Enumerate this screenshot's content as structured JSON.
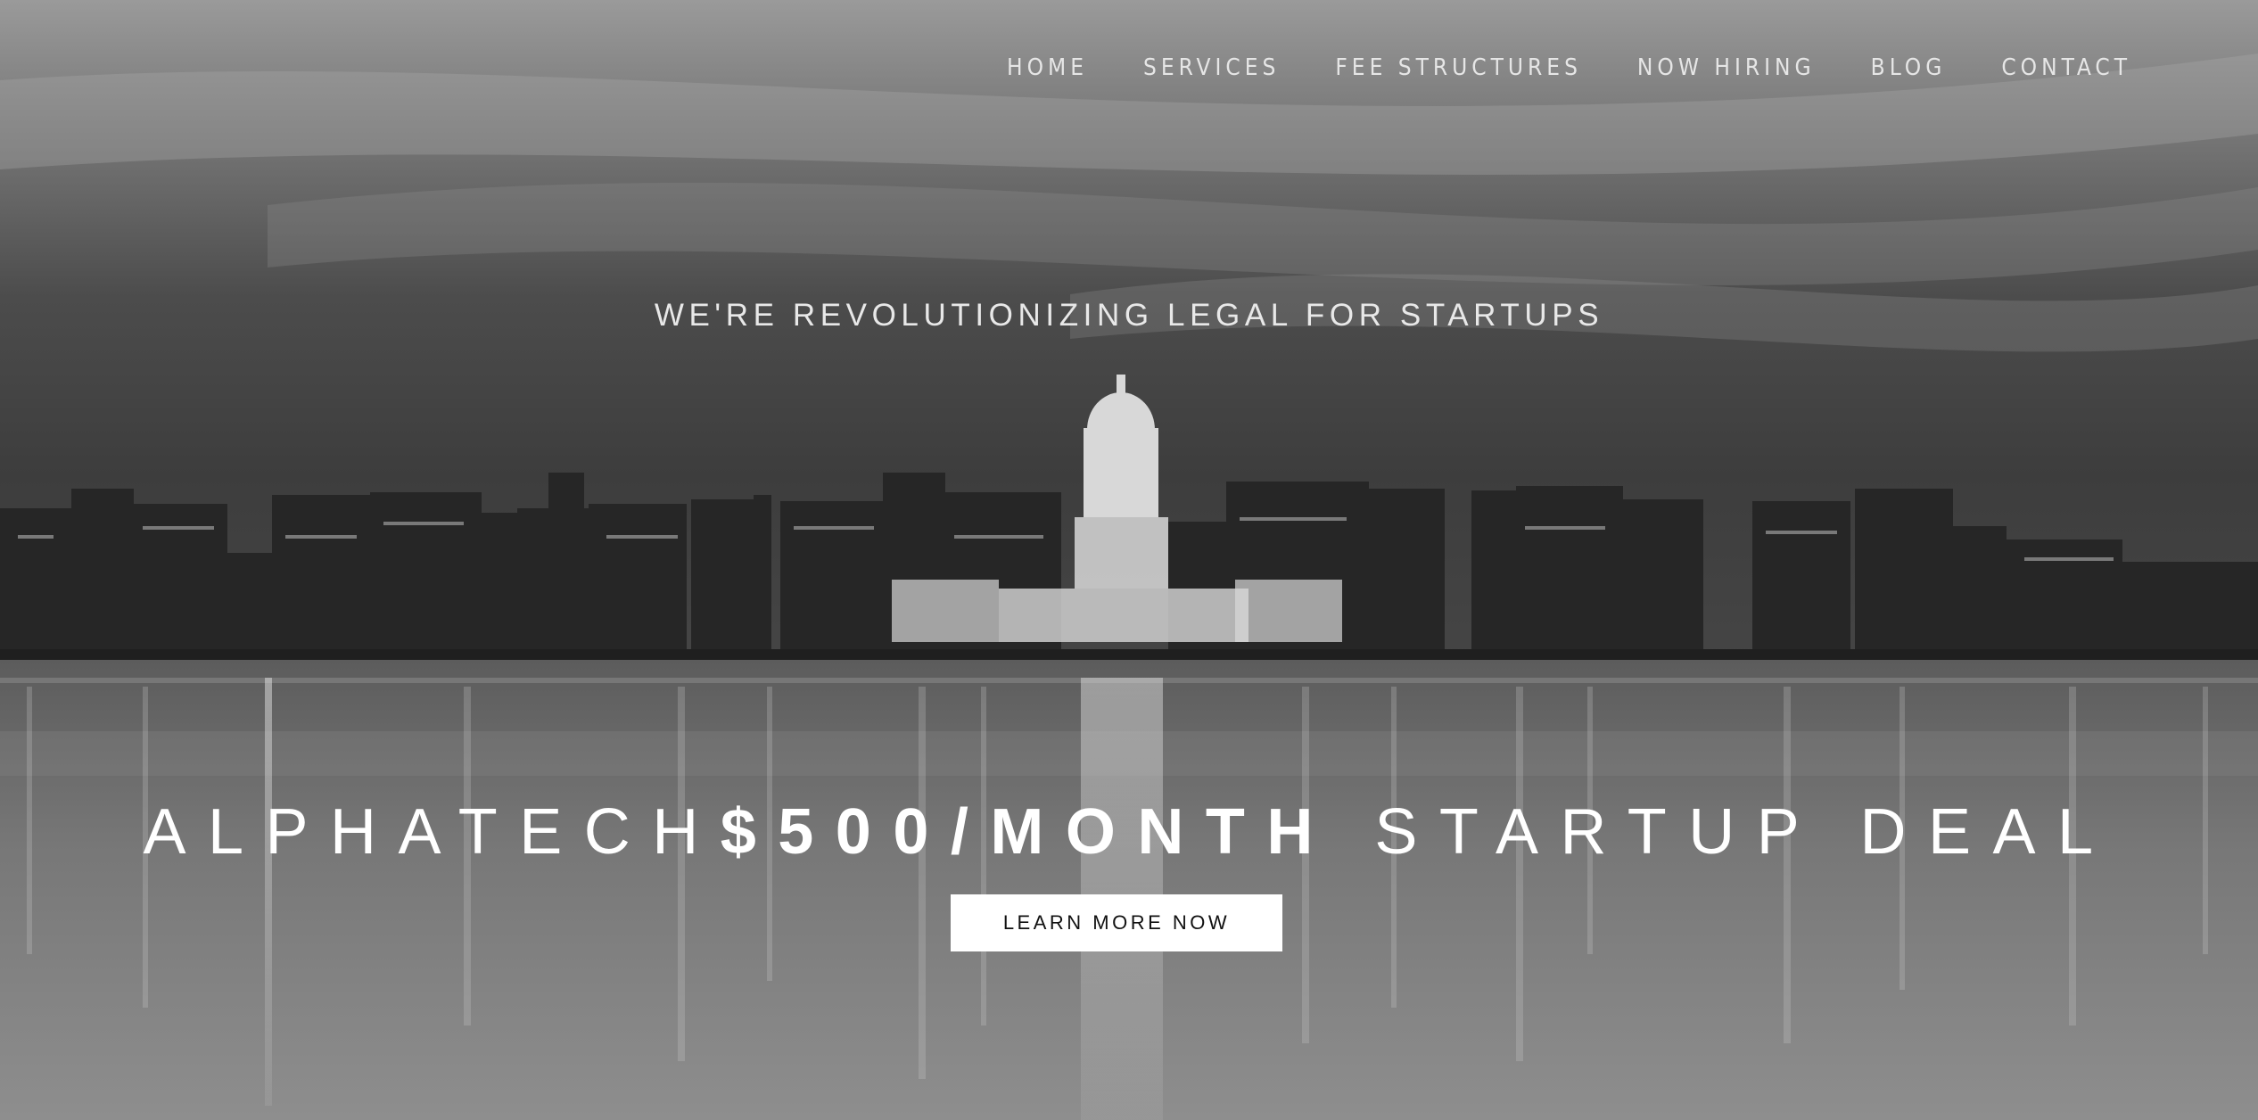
{
  "nav": {
    "items": [
      {
        "label": "HOME"
      },
      {
        "label": "SERVICES"
      },
      {
        "label": "FEE STRUCTURES"
      },
      {
        "label": "NOW HIRING"
      },
      {
        "label": "BLOG"
      },
      {
        "label": "CONTACT"
      }
    ]
  },
  "hero": {
    "tagline": "WE'RE REVOLUTIONIZING LEGAL FOR STARTUPS",
    "headline_brand": "ALPHATECH",
    "headline_offer": "$500/MONTH",
    "headline_rest": " STARTUP DEAL",
    "cta_label": "LEARN MORE NOW",
    "background": "city-skyline-night-reflection"
  },
  "colors": {
    "text": "#e6e6e6",
    "button_bg": "#ffffff",
    "button_text": "#111111"
  }
}
